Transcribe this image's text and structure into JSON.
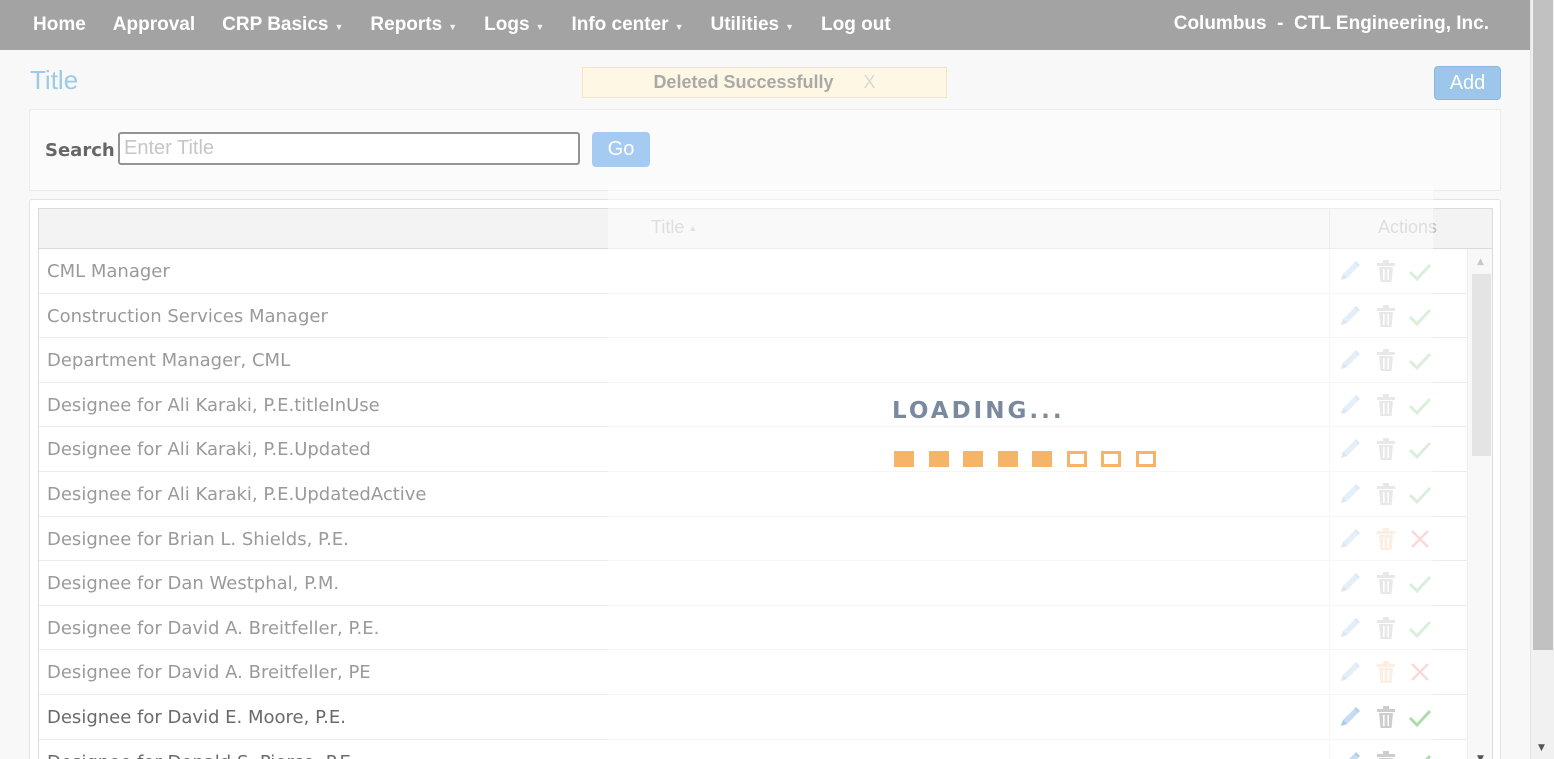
{
  "nav": {
    "items": [
      {
        "label": "Home",
        "caret": false
      },
      {
        "label": "Approval",
        "caret": false
      },
      {
        "label": "CRP Basics",
        "caret": true
      },
      {
        "label": "Reports",
        "caret": true
      },
      {
        "label": "Logs",
        "caret": true
      },
      {
        "label": "Info center",
        "caret": true
      },
      {
        "label": "Utilities",
        "caret": true
      },
      {
        "label": "Log out",
        "caret": false
      }
    ],
    "org": "Columbus  -  CTL Engineering, Inc."
  },
  "page": {
    "title": "Title",
    "alert": {
      "text": "Deleted Successfully",
      "close": "X"
    },
    "add_label": "Add"
  },
  "search": {
    "label": "Search",
    "placeholder": "Enter Title",
    "value": "",
    "go_label": "Go"
  },
  "table": {
    "columns": {
      "title": "Title",
      "actions": "Actions"
    },
    "sort": "ascending",
    "rows": [
      {
        "title": "CML Manager",
        "active": true
      },
      {
        "title": "Construction Services Manager",
        "active": true
      },
      {
        "title": "Department Manager, CML",
        "active": true
      },
      {
        "title": "Designee for Ali Karaki, P.E.titleInUse",
        "active": true
      },
      {
        "title": "Designee for Ali Karaki, P.E.Updated",
        "active": true
      },
      {
        "title": "Designee for Ali Karaki, P.E.UpdatedActive",
        "active": true
      },
      {
        "title": "Designee for Brian L. Shields, P.E.",
        "active": false
      },
      {
        "title": "Designee for Dan Westphal, P.M.",
        "active": true
      },
      {
        "title": "Designee for David A. Breitfeller, P.E.",
        "active": true
      },
      {
        "title": "Designee for David A. Breitfeller, PE",
        "active": false
      },
      {
        "title": "Designee for David E. Moore, P.E.",
        "active": true
      },
      {
        "title": "Designee for Donald S. Pierce, P.E.",
        "active": true
      }
    ]
  },
  "loading": {
    "text": "LOADING...",
    "filled_steps": 5,
    "total_steps": 8
  },
  "colors": {
    "nav_bg": "#a3a3a3",
    "title": "#9ccbe6",
    "edit_icon": "#8ab8e8",
    "delete_icon": "#9a9a9a",
    "delete_icon_inactive": "#f3b27a",
    "check_icon": "#5cb85c",
    "cross_icon": "#e05858",
    "loader": "#f5b468"
  },
  "icons": {
    "edit": "pencil-icon",
    "delete": "trash-icon",
    "active": "check-icon",
    "inactive": "cross-icon",
    "sort": "caret-up-icon"
  }
}
